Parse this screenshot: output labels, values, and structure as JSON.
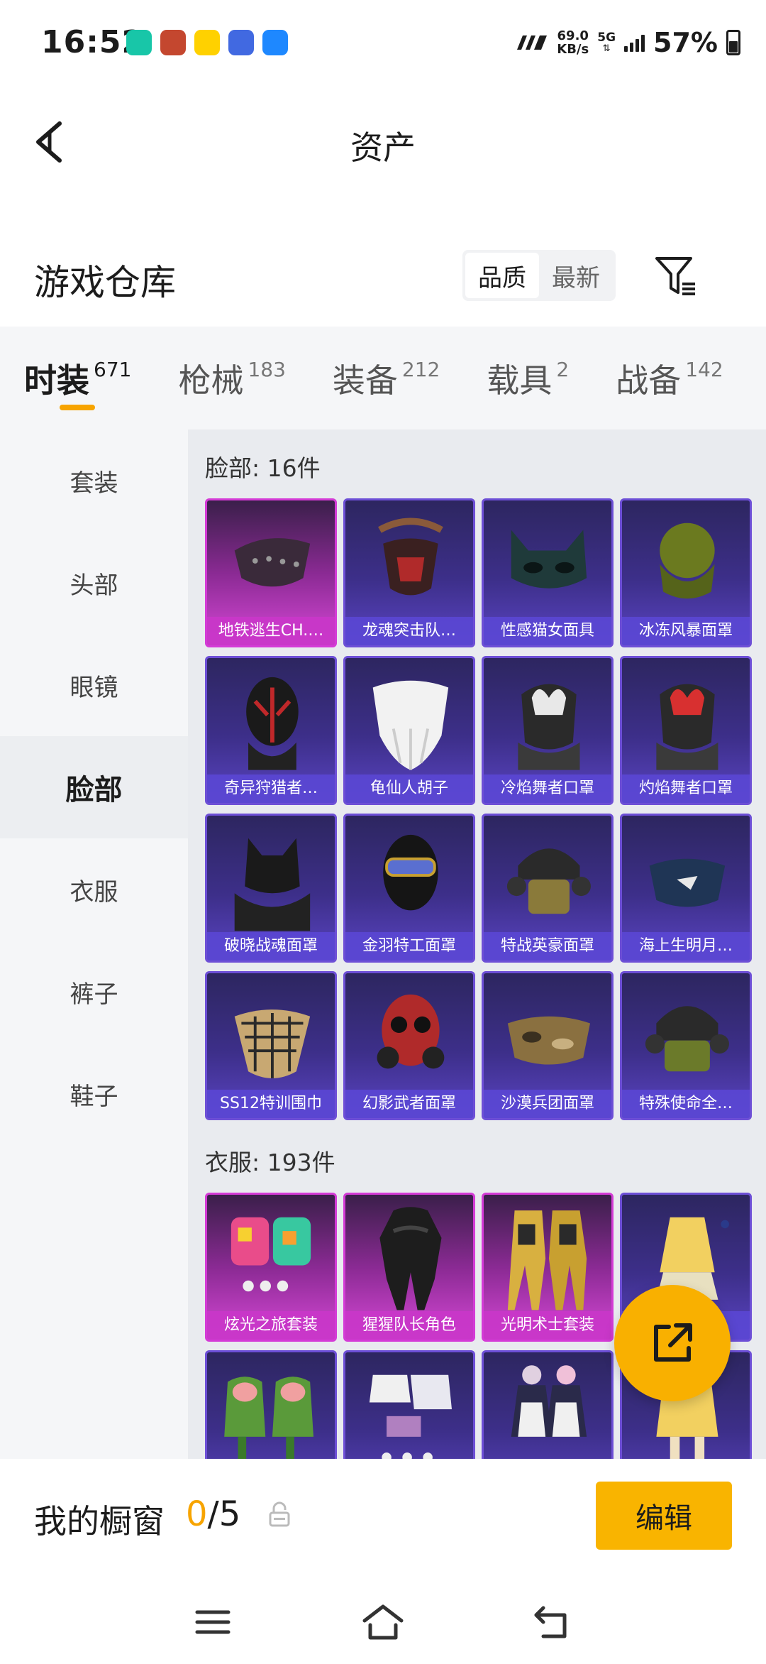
{
  "status_bar": {
    "time": "16:52",
    "net_speed": "69.0",
    "net_unit": "KB/s",
    "network": "5G",
    "battery": "57%",
    "app_icons": [
      {
        "name": "shield-app-icon",
        "color": "#18c6a8"
      },
      {
        "name": "game-app-icon",
        "color": "#c4472f"
      },
      {
        "name": "meituan-app-icon",
        "color": "#ffd100"
      },
      {
        "name": "vivo-app-icon",
        "color": "#4169e1"
      },
      {
        "name": "upload-app-icon",
        "color": "#1e88ff"
      }
    ]
  },
  "header": {
    "title": "资产"
  },
  "warehouse": {
    "title": "游戏仓库",
    "sort_options": [
      "品质",
      "最新"
    ],
    "active_sort": "品质"
  },
  "categories": [
    {
      "name": "时装",
      "count": "671"
    },
    {
      "name": "枪械",
      "count": "183"
    },
    {
      "name": "装备",
      "count": "212"
    },
    {
      "name": "载具",
      "count": "2"
    },
    {
      "name": "战备",
      "count": "142"
    }
  ],
  "sidebar": {
    "items": [
      "套装",
      "头部",
      "眼镜",
      "脸部",
      "衣服",
      "裤子",
      "鞋子"
    ],
    "active": "脸部"
  },
  "sections": [
    {
      "title": "脸部: 16件",
      "items": [
        {
          "label": "地铁逃生CH.…",
          "rarity": "legendary",
          "art": "spiked-mask"
        },
        {
          "label": "龙魂突击队…",
          "rarity": "epic",
          "art": "red-respirator"
        },
        {
          "label": "性感猫女面具",
          "rarity": "epic",
          "art": "cat-mask"
        },
        {
          "label": "冰冻风暴面罩",
          "rarity": "epic",
          "art": "green-scarf"
        },
        {
          "label": "奇异狩猎者…",
          "rarity": "epic",
          "art": "spider-mask"
        },
        {
          "label": "龟仙人胡子",
          "rarity": "epic",
          "art": "white-beard"
        },
        {
          "label": "冷焰舞者口罩",
          "rarity": "epic",
          "art": "white-flame-mask"
        },
        {
          "label": "灼焰舞者口罩",
          "rarity": "epic",
          "art": "red-flame-mask"
        },
        {
          "label": "破晓战魂面罩",
          "rarity": "epic",
          "art": "black-wolf-mask"
        },
        {
          "label": "金羽特工面罩",
          "rarity": "epic",
          "art": "goggles-balaclava"
        },
        {
          "label": "特战英豪面罩",
          "rarity": "epic",
          "art": "tactical-helmet"
        },
        {
          "label": "海上生明月…",
          "rarity": "epic",
          "art": "blue-mask"
        },
        {
          "label": "SS12特训围巾",
          "rarity": "epic",
          "art": "checkered-scarf"
        },
        {
          "label": "幻影武者面罩",
          "rarity": "epic",
          "art": "red-gas-mask"
        },
        {
          "label": "沙漠兵团面罩",
          "rarity": "epic",
          "art": "camo-mask"
        },
        {
          "label": "特殊使命全…",
          "rarity": "epic",
          "art": "olive-helmet"
        }
      ]
    },
    {
      "title": "衣服: 193件",
      "items": [
        {
          "label": "炫光之旅套装",
          "rarity": "legendary",
          "art": "rainbow-jackets"
        },
        {
          "label": "猩猩队长角色",
          "rarity": "legendary",
          "art": "gorilla-suit"
        },
        {
          "label": "光明术士套装",
          "rarity": "legendary",
          "art": "gold-armor"
        },
        {
          "label": "装",
          "rarity": "epic",
          "art": "yellow-dress"
        },
        {
          "label": "",
          "rarity": "epic",
          "art": "green-tops"
        },
        {
          "label": "",
          "rarity": "epic",
          "art": "white-outfit"
        },
        {
          "label": "",
          "rarity": "epic",
          "art": "maid-outfit"
        },
        {
          "label": "",
          "rarity": "epic",
          "art": "yellow-outfit"
        }
      ]
    }
  ],
  "showcase": {
    "label": "我的橱窗",
    "used": "0",
    "total": "/5",
    "edit_label": "编辑"
  },
  "colors": {
    "accent": "#f7a400",
    "legendary": "#d43bd6",
    "epic": "#6d4fd6"
  }
}
